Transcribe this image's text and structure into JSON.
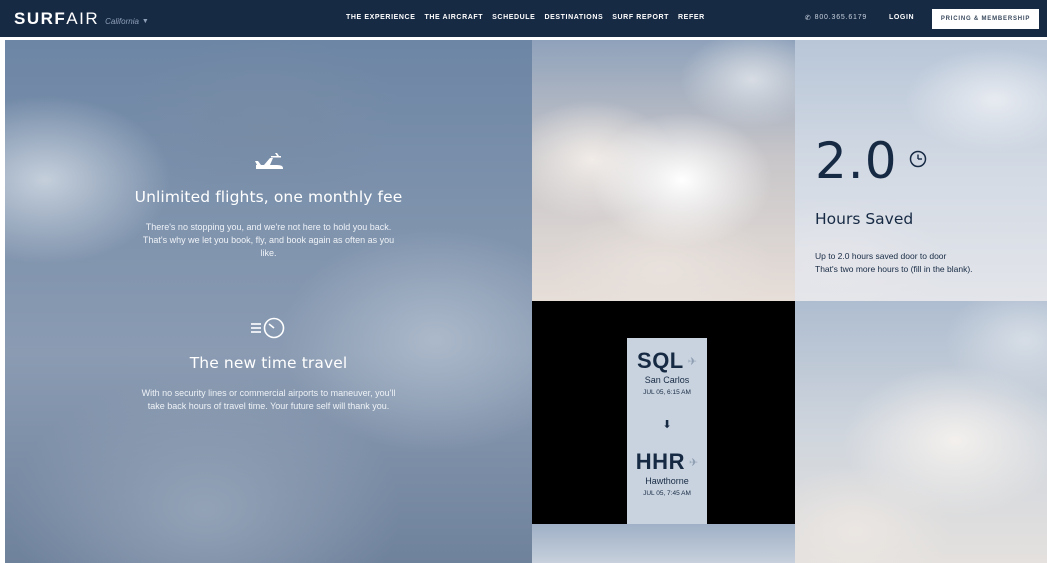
{
  "nav": {
    "brand_bold": "SURF",
    "brand_thin": "AIR",
    "region": "California",
    "links": [
      "THE EXPERIENCE",
      "THE AIRCRAFT",
      "SCHEDULE",
      "DESTINATIONS",
      "SURF REPORT",
      "REFER"
    ],
    "phone": "800.365.6179",
    "login": "LOGIN",
    "cta": "PRICING & MEMBERSHIP"
  },
  "features": [
    {
      "icon": "plane-icon",
      "title": "Unlimited flights, one monthly fee",
      "body": "There's no stopping you, and we're not here to hold you back. That's why we let you book, fly, and book again as often as you like."
    },
    {
      "icon": "fast-clock-icon",
      "title": "The new time travel",
      "body": "With no security lines or commercial airports to maneuver, you'll take back hours of travel time. Your future self will thank you."
    }
  ],
  "stat": {
    "value": "2.0",
    "label": "Hours Saved",
    "desc_line1": "Up to 2.0 hours saved door to door",
    "desc_line2": "That's two more hours to (fill in the blank)."
  },
  "flight": {
    "from_code": "SQL",
    "from_city": "San Carlos",
    "from_time": "JUL 05, 6:15 AM",
    "to_code": "HHR",
    "to_city": "Hawthorne",
    "to_time": "JUL 05, 7:45 AM"
  },
  "colors": {
    "navy": "#172a44",
    "ticket_bg": "#c9d3df"
  }
}
